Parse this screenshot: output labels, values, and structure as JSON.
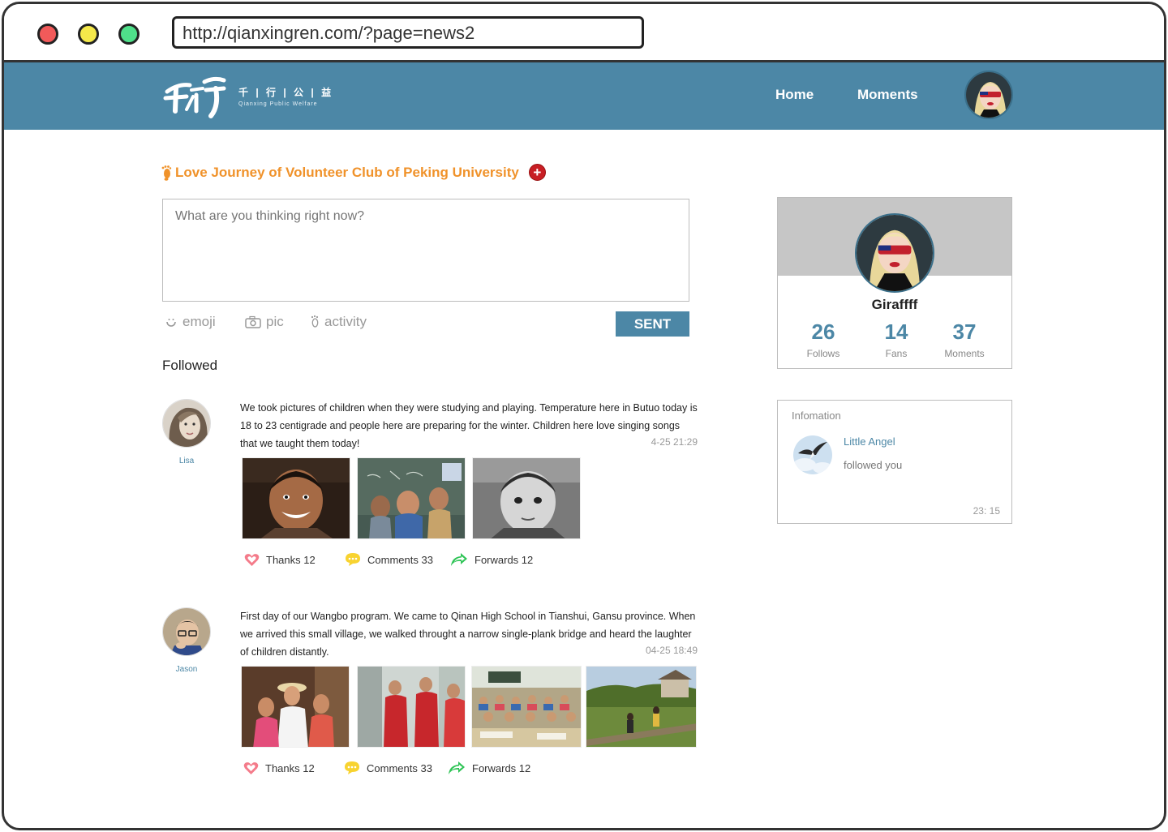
{
  "browser": {
    "url": "http://qianxingren.com/?page=news2"
  },
  "navbar": {
    "logo_cn": "千 | 行 | 公 | 益",
    "logo_en": "Qianxing Public Welfare",
    "home_label": "Home",
    "moments_label": "Moments"
  },
  "club": {
    "title": "Love Journey of Volunteer Club of Peking University",
    "add_symbol": "+"
  },
  "composer": {
    "placeholder": "What are you thinking right now?",
    "emoji_label": "emoji",
    "pic_label": "pic",
    "activity_label": "activity",
    "send_label": "SENT"
  },
  "feed": {
    "heading": "Followed",
    "posts": [
      {
        "author": "Lisa",
        "text": "We took pictures of children when they were studying and playing. Temperature here in Butuo today is 18 to 23 centigrade and people here are preparing for the winter. Children here love singing songs that we  taught them today!",
        "time": "4-25  21:29",
        "thanks": "Thanks 12",
        "comments": "Comments 33",
        "forwards": "Forwards 12"
      },
      {
        "author": "Jason",
        "text": "First day of our Wangbo program. We came to Qinan High School in Tianshui, Gansu province. When we arrived this small village, we walked throught a narrow single-plank bridge and heard the laughter of children distantly.",
        "time": "04-25  18:49",
        "thanks": "Thanks 12",
        "comments": "Comments 33",
        "forwards": "Forwards 12"
      }
    ]
  },
  "profile": {
    "name": "Giraffff",
    "follows_count": "26",
    "follows_label": "Follows",
    "fans_count": "14",
    "fans_label": "Fans",
    "moments_count": "37",
    "moments_label": "Moments"
  },
  "information": {
    "title": "Infomation",
    "sender": "Little Angel",
    "message": "followed you",
    "time": "23: 15"
  },
  "colors": {
    "brand_blue": "#4c87a6",
    "accent_orange": "#f0922a",
    "add_red": "#c81e24"
  }
}
